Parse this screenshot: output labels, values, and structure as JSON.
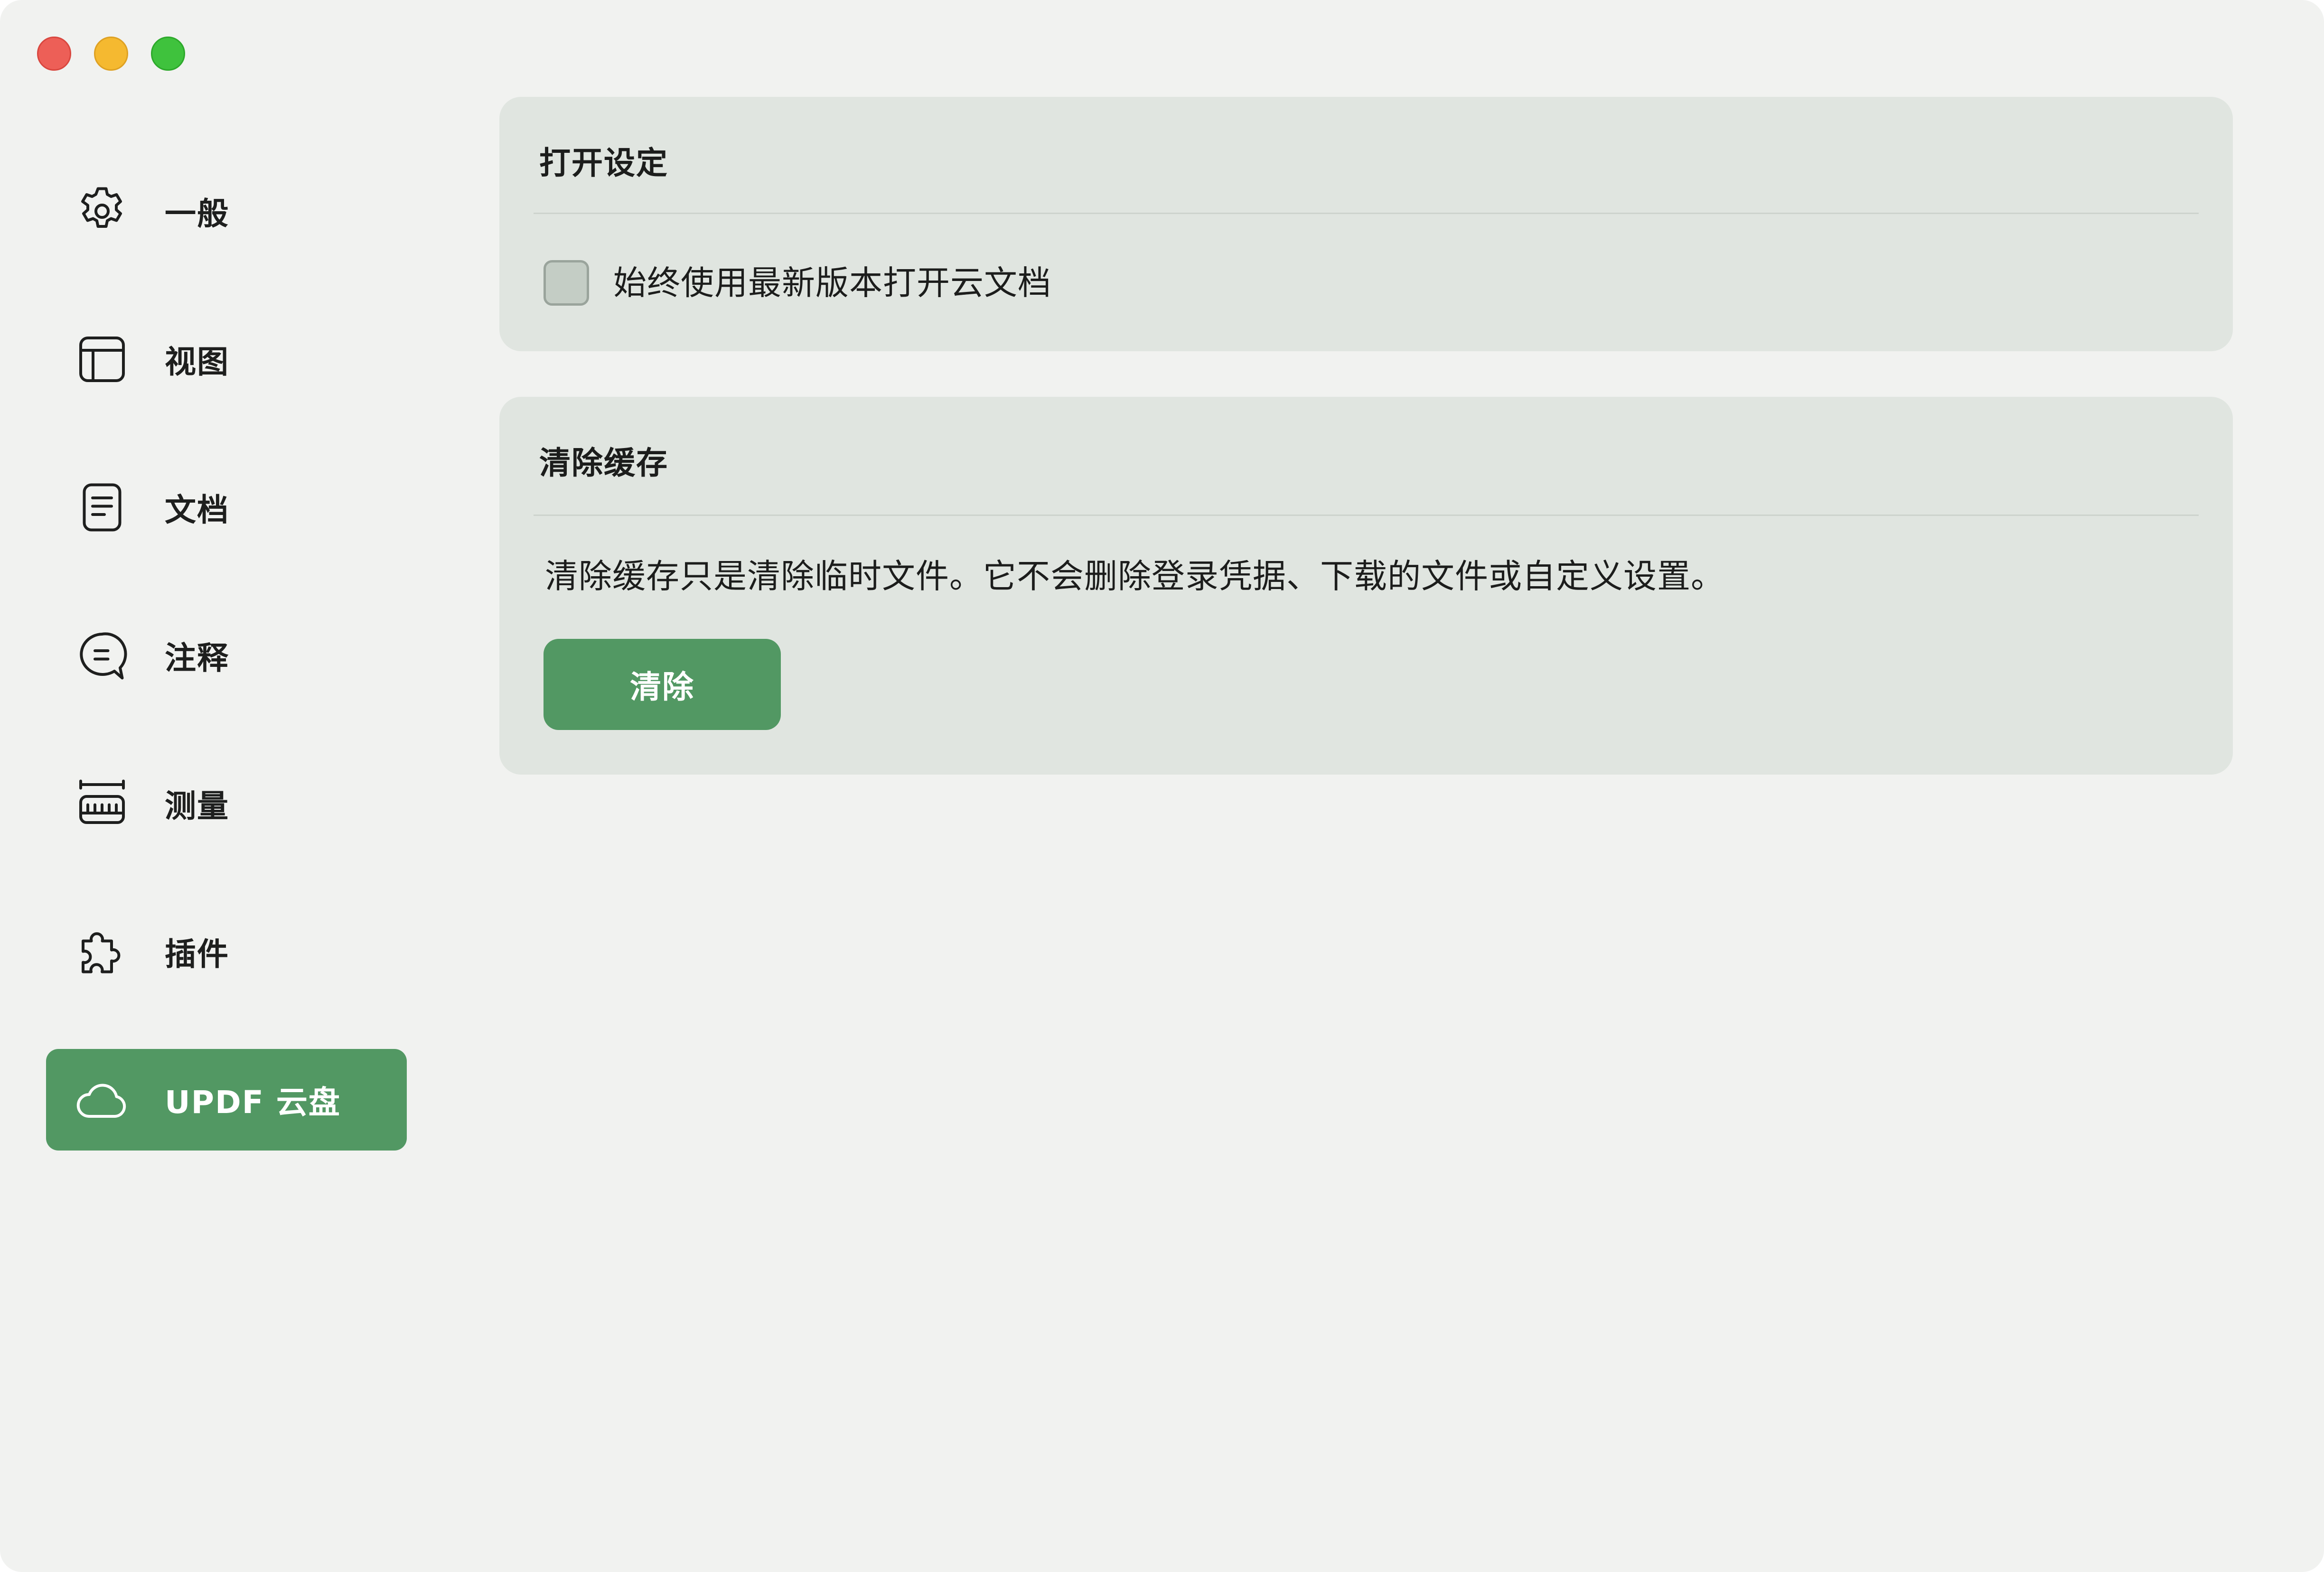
{
  "window": {
    "controls": [
      "close",
      "minimize",
      "maximize"
    ]
  },
  "sidebar": {
    "items": [
      {
        "label": "一般",
        "icon": "gear-icon",
        "active": false
      },
      {
        "label": "视图",
        "icon": "layout-icon",
        "active": false
      },
      {
        "label": "文档",
        "icon": "document-icon",
        "active": false
      },
      {
        "label": "注释",
        "icon": "comment-icon",
        "active": false
      },
      {
        "label": "测量",
        "icon": "ruler-icon",
        "active": false
      },
      {
        "label": "插件",
        "icon": "puzzle-icon",
        "active": false
      },
      {
        "label": "UPDF 云盘",
        "icon": "cloud-icon",
        "active": true
      }
    ]
  },
  "open_settings": {
    "title": "打开设定",
    "checkbox_label": "始终使用最新版本打开云文档",
    "checked": false
  },
  "clear_cache": {
    "title": "清除缓存",
    "description": "清除缓存只是清除临时文件。它不会删除登录凭据、下载的文件或自定义设置。",
    "button_label": "清除"
  },
  "colors": {
    "accent": "#529863",
    "card_background": "#e0e5e0",
    "window_background": "#f1f2f0"
  }
}
